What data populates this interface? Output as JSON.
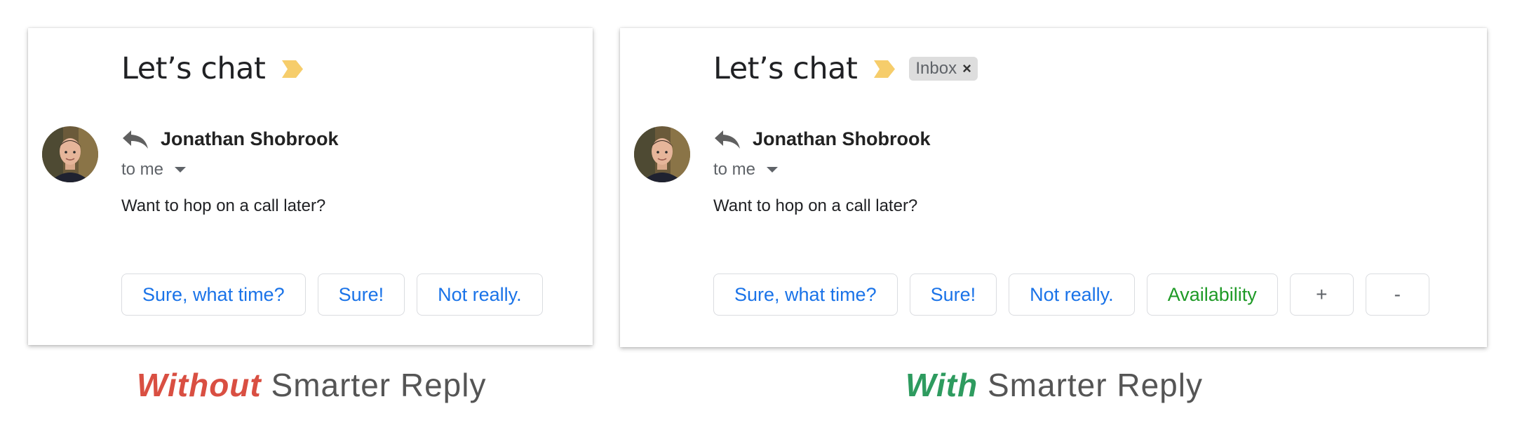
{
  "colors": {
    "link_blue": "#1a73e8",
    "green_chip": "#1e9a26",
    "without_red": "#d94f42",
    "with_green": "#2e9b5f",
    "important_marker": "#f6cd6b"
  },
  "left": {
    "subject": "Let’s chat",
    "sender": "Jonathan Shobrook",
    "to": "to me",
    "body": "Want to hop on a call later?",
    "replies": [
      "Sure, what time?",
      "Sure!",
      "Not really."
    ]
  },
  "right": {
    "subject": "Let’s chat",
    "inbox_label": "Inbox",
    "inbox_close": "×",
    "sender": "Jonathan Shobrook",
    "to": "to me",
    "body": "Want to hop on a call later?",
    "replies": [
      "Sure, what time?",
      "Sure!",
      "Not really."
    ],
    "extra_reply": "Availability",
    "plus": "+",
    "minus": "-"
  },
  "captions": {
    "without_word": "Without",
    "with_word": "With",
    "suffix": "Smarter Reply"
  },
  "icons": [
    "important-marker-icon",
    "reply-arrow-icon",
    "dropdown-caret-icon",
    "close-icon"
  ]
}
